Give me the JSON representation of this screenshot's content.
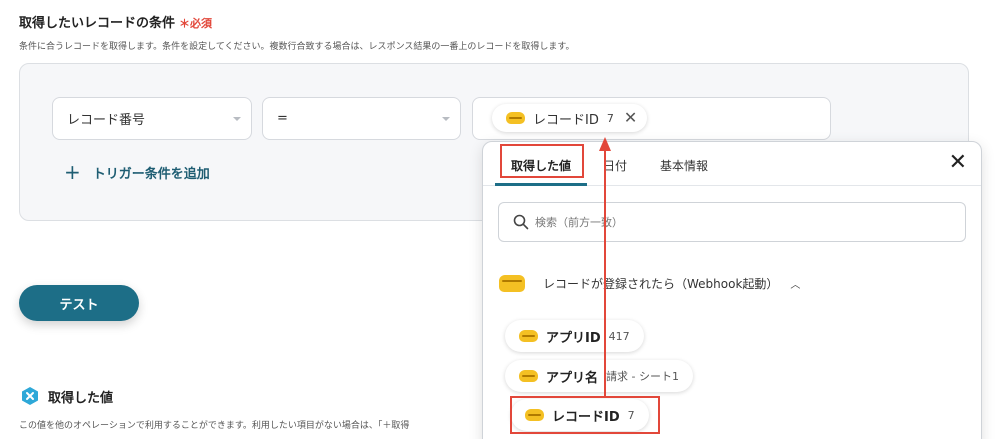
{
  "section": {
    "title": "取得したいレコードの条件",
    "required_mark": "＊",
    "required_label": "必須",
    "description": "条件に合うレコードを取得します。条件を設定してください。複数行合致する場合は、レスポンス結果の一番上のレコードを取得します。"
  },
  "condition": {
    "field": "レコード番号",
    "operator": "=",
    "value_chip": {
      "label": "レコードID",
      "value": "7",
      "icon": "kintone-icon"
    },
    "add_trigger_label": "トリガー条件を追加"
  },
  "test_button": "テスト",
  "obtained": {
    "title": "取得した値",
    "description": "この値を他のオペレーションで利用することができます。利用したい項目がない場合は、「＋取得"
  },
  "popup": {
    "tabs": [
      "取得した値",
      "日付",
      "基本情報"
    ],
    "search_placeholder": "検索（前方一致）",
    "group_label": "レコードが登録されたら（Webhook起動）",
    "items": [
      {
        "label": "アプリID",
        "value": "417"
      },
      {
        "label": "アプリ名",
        "value": "請求 - シート1"
      },
      {
        "label": "レコードID",
        "value": "7"
      }
    ]
  },
  "colors": {
    "accent": "#1d6e87",
    "required": "#e2473a",
    "highlight": "#e2473a",
    "kintone": "#f4c023"
  }
}
